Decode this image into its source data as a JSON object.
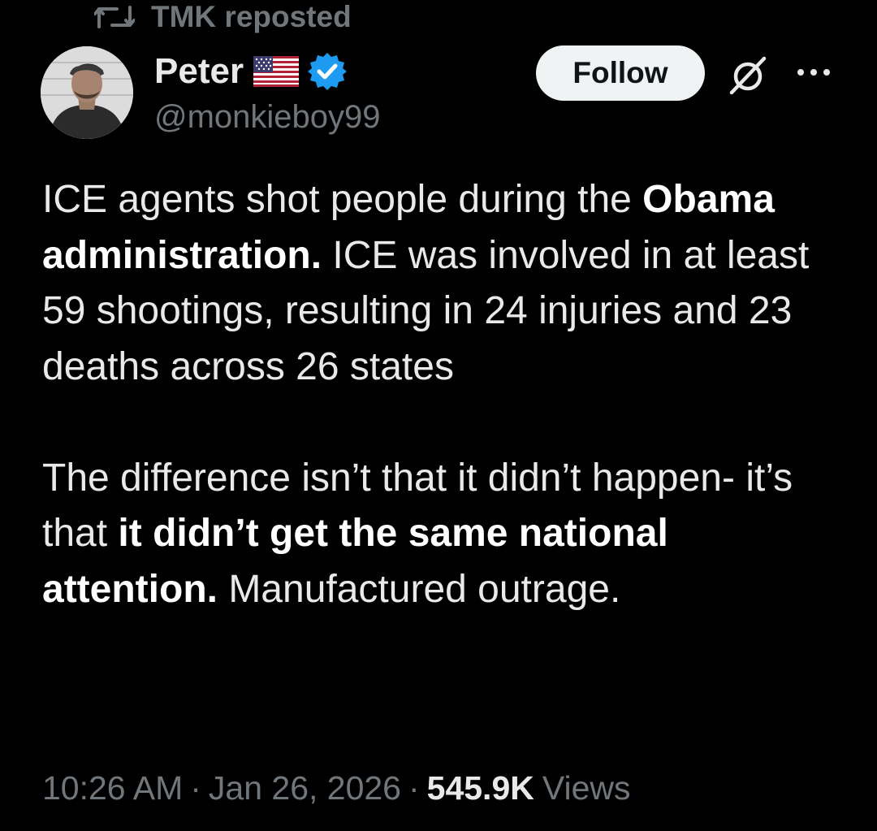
{
  "repost": {
    "text": "TMK reposted",
    "icon": "retweet-icon"
  },
  "author": {
    "name": "Peter",
    "handle": "@monkieboy99",
    "flag_icon": "us-flag-icon",
    "verified_icon": "verified-badge-icon",
    "verified_color": "#1d9bf0",
    "avatar": "profile-photo"
  },
  "actions": {
    "follow_label": "Follow",
    "grok_icon": "grok-icon",
    "more_icon": "more-options-icon"
  },
  "tweet": {
    "p1_a": "ICE agents shot people during the ",
    "p1_bold": "Obama administration.",
    "p1_b": " ICE was involved in at least 59 shootings, resulting in 24 injuries and 23 deaths across 26 states",
    "p2_a": "The difference isn’t that it didn’t happen- it’s that ",
    "p2_bold": "it didn’t get the same national attention.",
    "p2_b": " Manufactured outrage."
  },
  "meta": {
    "time": "10:26 AM",
    "separator": "·",
    "date": "Jan 26, 2026",
    "views_count": "545.9K",
    "views_label": "Views"
  },
  "colors": {
    "background": "#000000",
    "primary_text": "#e7e9ea",
    "secondary_text": "#71767b",
    "follow_bg": "#eff3f4"
  }
}
